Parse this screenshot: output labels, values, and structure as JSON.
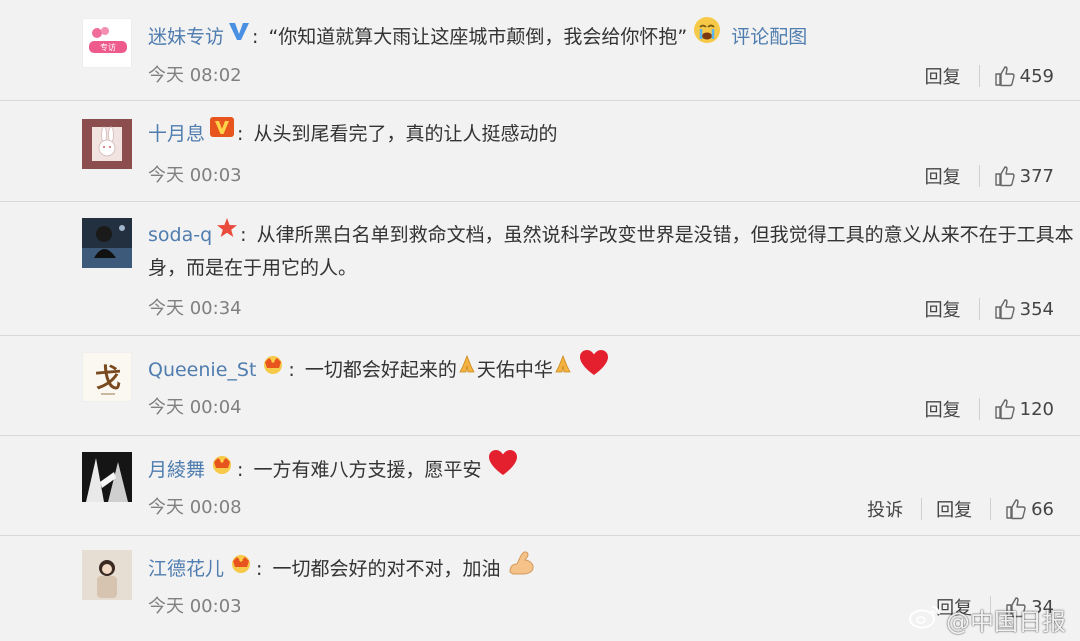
{
  "comments": [
    {
      "user": "迷妹专访",
      "text": "“你知道就算大雨让这座城市颠倒，我会给你怀抱”",
      "link": "评论配图",
      "time": "今天 08:02",
      "reply": "回复",
      "likes": "459"
    },
    {
      "user": "十月息",
      "text": "从头到尾看完了，真的让人挺感动的",
      "time": "今天 00:03",
      "reply": "回复",
      "likes": "377"
    },
    {
      "user": "soda-q",
      "text": "从律所黑白名单到救命文档，虽然说科学改变世界是没错，但我觉得工具的意义从来不在于工具本身，而是在于用它的人。",
      "time": "今天 00:34",
      "reply": "回复",
      "likes": "354"
    },
    {
      "user": "Queenie_St",
      "text": "一切都会好起来的",
      "text2": "天佑中华",
      "time": "今天 00:04",
      "reply": "回复",
      "likes": "120"
    },
    {
      "user": "月綾舞",
      "text": "一方有难八方支援，愿平安",
      "time": "今天 00:08",
      "report": "投诉",
      "reply": "回复",
      "likes": "66"
    },
    {
      "user": "江德花儿",
      "text": "一切都会好的对不对，加油",
      "time": "今天 00:03",
      "reply": "回复",
      "likes": "34"
    }
  ],
  "watermark": "@中国日报",
  "colors": {
    "username": "#507daf",
    "background": "#f2f2f2",
    "heart": "#e5202e"
  }
}
